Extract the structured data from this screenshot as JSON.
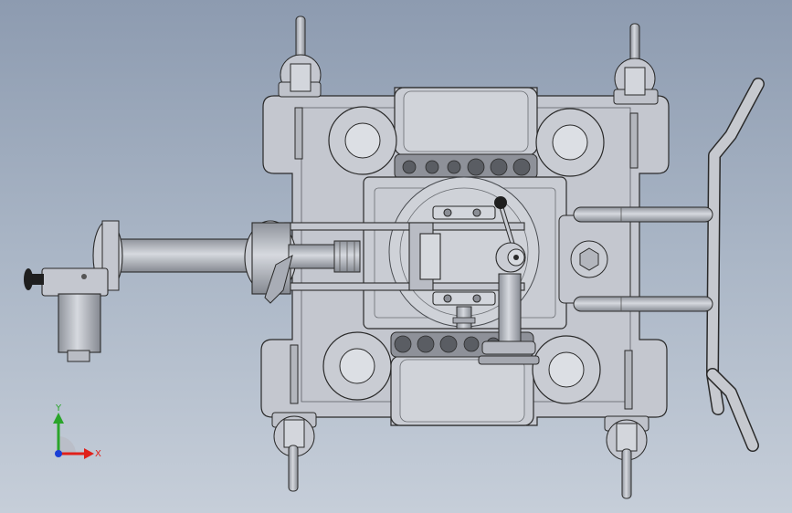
{
  "view": {
    "background_top": "#8d9bb0",
    "background_bottom": "#c6ced9"
  },
  "triad": {
    "x_label": "X",
    "y_label": "Y",
    "x_color": "#e0201a",
    "y_color": "#2aa52a",
    "z_color": "#1b3fd6"
  },
  "colors": {
    "part_fill": "#c4c7cf",
    "part_dark": "#a9adb6",
    "edge": "#2a2a2a",
    "hole": "#53565c"
  }
}
